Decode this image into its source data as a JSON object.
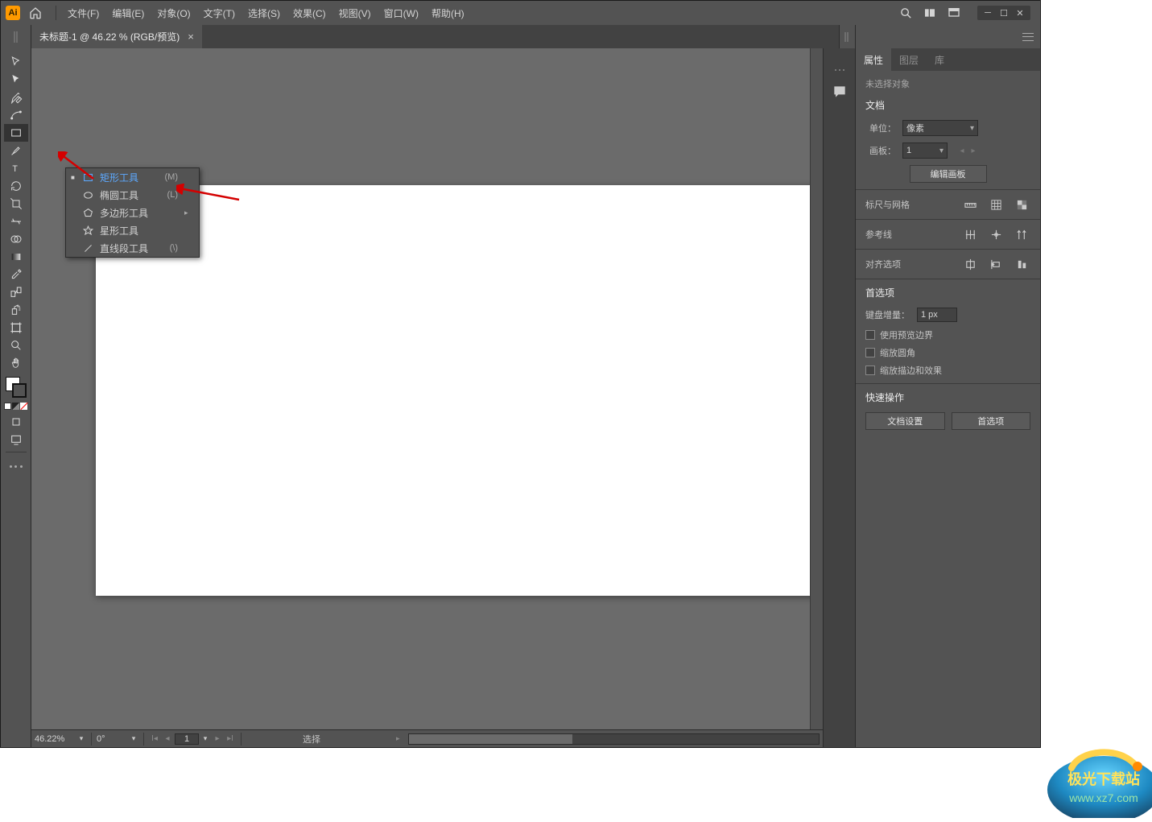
{
  "app": {
    "logo": "Ai"
  },
  "menu": [
    "文件(F)",
    "编辑(E)",
    "对象(O)",
    "文字(T)",
    "选择(S)",
    "效果(C)",
    "视图(V)",
    "窗口(W)",
    "帮助(H)"
  ],
  "doc_tab": {
    "title": "未标题-1 @ 46.22 % (RGB/预览)"
  },
  "flyout": {
    "items": [
      {
        "label": "矩形工具",
        "shortcut": "(M)",
        "sel": true,
        "icon": "rect",
        "mark": "■"
      },
      {
        "label": "椭圆工具",
        "shortcut": "(L)",
        "sel": false,
        "icon": "ellipse",
        "mark": ""
      },
      {
        "label": "多边形工具",
        "shortcut": "",
        "sel": false,
        "icon": "polygon",
        "mark": "",
        "arrow": true
      },
      {
        "label": "星形工具",
        "shortcut": "",
        "sel": false,
        "icon": "star",
        "mark": ""
      },
      {
        "label": "直线段工具",
        "shortcut": "(\\)",
        "sel": false,
        "icon": "line",
        "mark": ""
      }
    ]
  },
  "status": {
    "zoom": "46.22%",
    "angle": "0°",
    "page": "1",
    "mode": "选择"
  },
  "panel": {
    "tabs": [
      "属性",
      "图层",
      "库"
    ],
    "no_selection": "未选择对象",
    "doc_header": "文档",
    "unit_label": "单位：",
    "unit_value": "像素",
    "artboard_label": "画板：",
    "artboard_value": "1",
    "edit_artboard": "编辑画板",
    "ruler_grid": "标尺与网格",
    "guides": "参考线",
    "align": "对齐选项",
    "prefs": "首选项",
    "kb_inc_label": "键盘增量：",
    "kb_inc_value": "1 px",
    "chk1": "使用预览边界",
    "chk2": "缩放圆角",
    "chk3": "缩放描边和效果",
    "quick": "快速操作",
    "btn_doc": "文档设置",
    "btn_pref": "首选项"
  }
}
